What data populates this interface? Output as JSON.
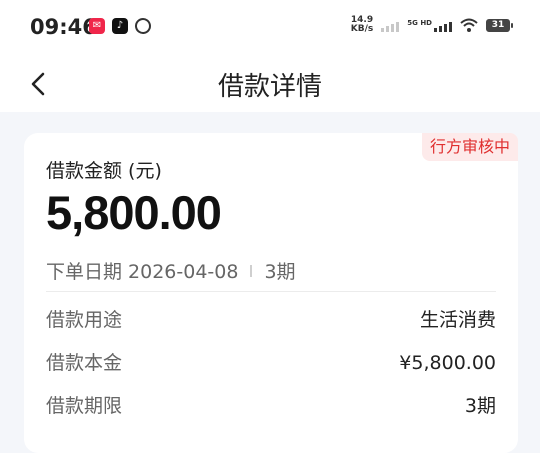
{
  "status_bar": {
    "time": "09:46",
    "speed_value": "14.9",
    "speed_unit": "KB/s",
    "network_label": "5G HD",
    "battery": "31"
  },
  "nav": {
    "title": "借款详情"
  },
  "loan": {
    "status": "行方审核中",
    "amount_label": "借款金额 (元)",
    "amount": "5,800.00",
    "order_date": "下单日期 2026-04-08",
    "periods": "3期",
    "details": [
      {
        "label": "借款用途",
        "value": "生活消费"
      },
      {
        "label": "借款本金",
        "value": "¥5,800.00"
      },
      {
        "label": "借款期限",
        "value": "3期"
      }
    ]
  }
}
